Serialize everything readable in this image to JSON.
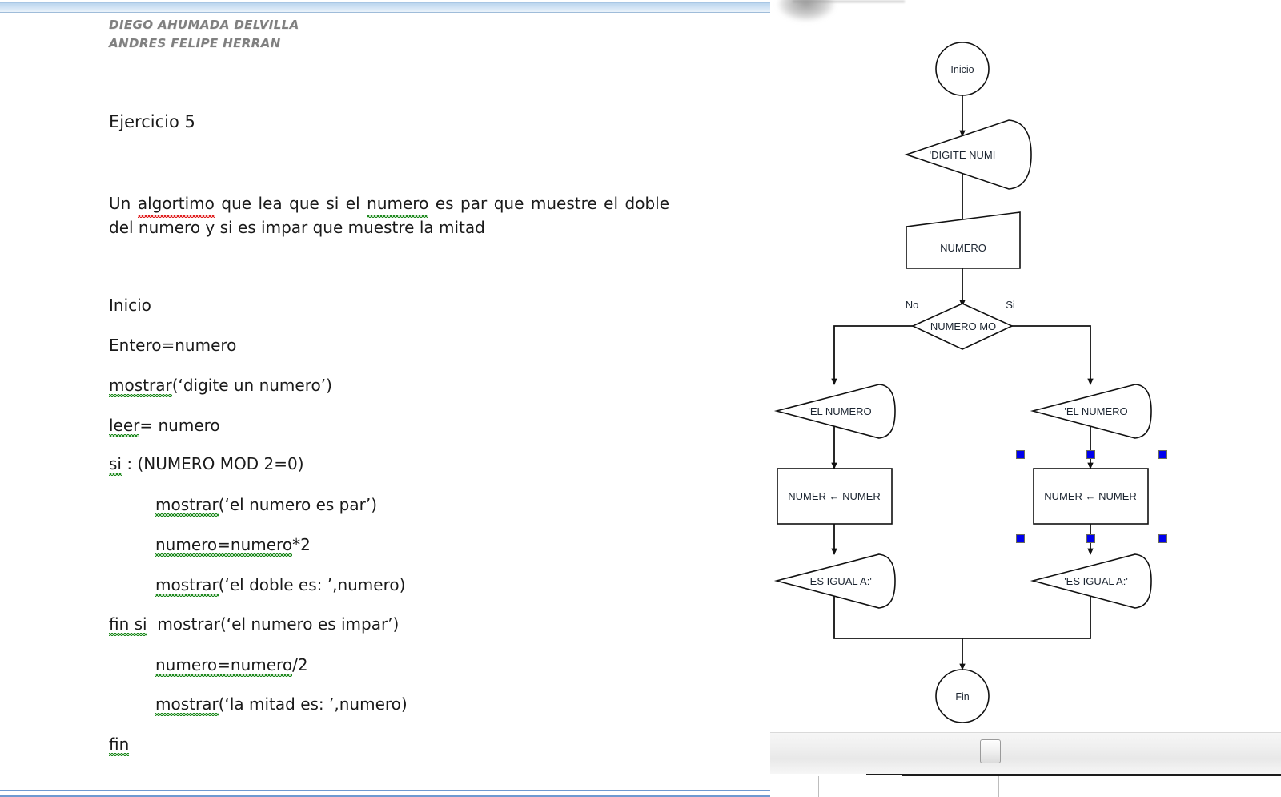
{
  "document": {
    "authors": [
      "DIEGO AHUMADA DELVILLA",
      "ANDRES FELIPE HERRAN"
    ],
    "exercise_title": "Ejercicio 5",
    "problem_statement": "Un algortimo que lea que si el numero es par que muestre el doble del numero y si es impar que muestre la mitad",
    "problem_statement_parts": {
      "before_red": "Un ",
      "red_word": "algortimo",
      "middle": " que lea que si el ",
      "green_word": "numero",
      "after": " es par que muestre el doble del numero y si es impar que muestre la mitad"
    },
    "algorithm_lines": [
      {
        "text": "Inicio",
        "indent": 0
      },
      {
        "text": "Entero=numero",
        "indent": 0
      },
      {
        "text": "mostrar(‘digite un numero’)",
        "indent": 0,
        "green_prefix": "mostrar"
      },
      {
        "text": "leer= numero",
        "indent": 0,
        "green_prefix": "leer"
      },
      {
        "text": "si : (NUMERO MOD 2=0)",
        "indent": 0,
        "green_prefix": "si"
      },
      {
        "text": "mostrar(‘el numero es par’)",
        "indent": 1,
        "green_prefix": "mostrar"
      },
      {
        "text": "numero=numero*2",
        "indent": 1,
        "green_prefix": "numero=numero"
      },
      {
        "text": "mostrar(‘el doble es: ’,numero)",
        "indent": 1,
        "green_prefix": "mostrar"
      },
      {
        "text": "fin si  mostrar(‘el numero es impar’)",
        "indent": 0,
        "green_prefix": "fin si"
      },
      {
        "text": "numero=numero/2",
        "indent": 1,
        "green_prefix": "numero=numero"
      },
      {
        "text": "mostrar(‘la mitad es: ’,numero)",
        "indent": 1,
        "green_prefix": "mostrar"
      },
      {
        "text": "fin",
        "indent": 0,
        "green_prefix": "fin"
      }
    ],
    "spellcheck": {
      "red_color": "#e02020",
      "green_color": "#1f8a1f"
    }
  },
  "flowchart": {
    "nodes": {
      "start": {
        "label": "Inicio",
        "shape": "terminator-circle"
      },
      "prompt_display": {
        "label": "'DIGITE NUMI",
        "shape": "display"
      },
      "input_numero": {
        "label": "NUMERO",
        "shape": "manual-input"
      },
      "decision": {
        "label": "NUMERO MO",
        "shape": "decision"
      },
      "left_display": {
        "label": "'EL NUMERO",
        "shape": "display"
      },
      "left_process": {
        "label": "NUMER ← NUMER",
        "shape": "process"
      },
      "left_result_display": {
        "label": "'ES IGUAL A:'",
        "shape": "display"
      },
      "right_display": {
        "label": "'EL NUMERO",
        "shape": "display"
      },
      "right_process": {
        "label": "NUMER ← NUMER",
        "shape": "process"
      },
      "right_result_display": {
        "label": "'ES IGUAL A:'",
        "shape": "display"
      },
      "end": {
        "label": "Fin",
        "shape": "terminator-circle"
      }
    },
    "branch_labels": {
      "left": "No",
      "right": "Si"
    },
    "selection": {
      "selected_node": "right_process",
      "handle_color": "#0000ee",
      "handle_border_color": "#6b6b5a",
      "handle_count": 6
    },
    "stroke_color": "#111111",
    "fill_color": "#ffffff"
  },
  "window": {
    "ruler_color": "#bcd6ee",
    "scroll_thumb_present": true
  }
}
